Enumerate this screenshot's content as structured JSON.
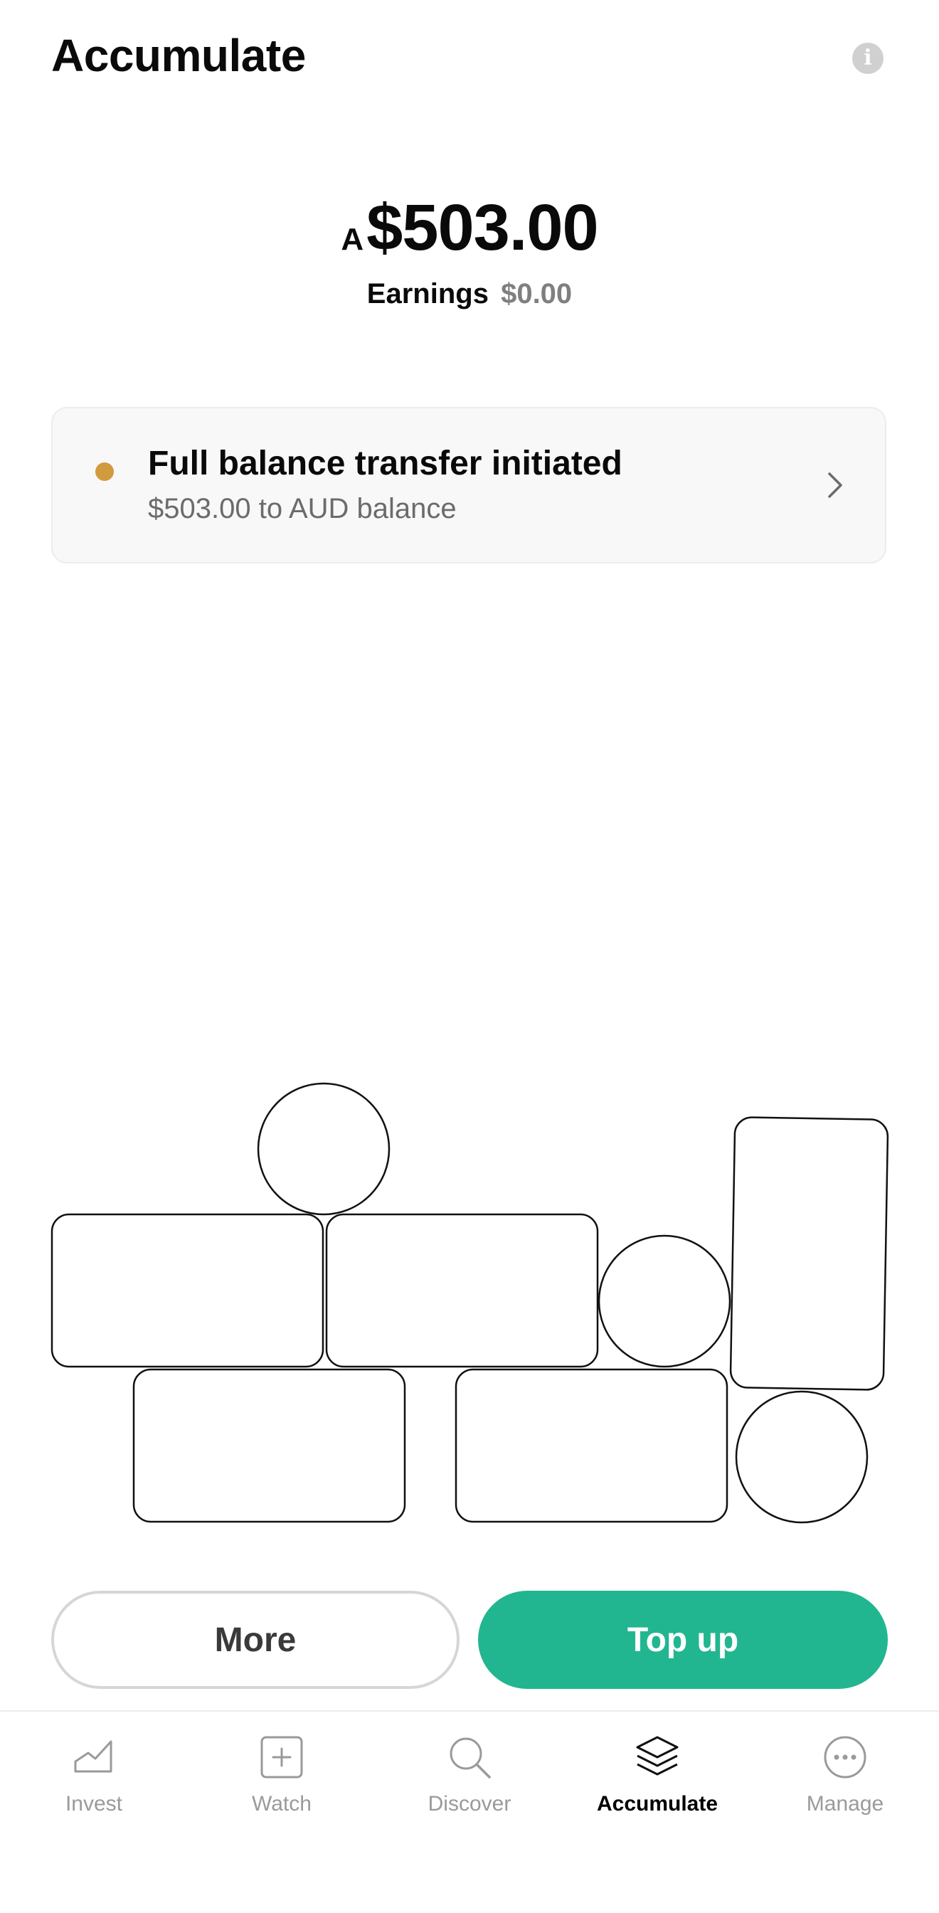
{
  "header": {
    "title": "Accumulate",
    "info_icon": "info-icon",
    "info_glyph": "i"
  },
  "balance": {
    "currency_prefix": "A",
    "amount": "$503.00",
    "earnings_label": "Earnings",
    "earnings_value": "$0.00"
  },
  "notice": {
    "status_color": "#d29a3f",
    "title": "Full balance transfer initiated",
    "subtitle": "$503.00 to AUD balance",
    "chevron_icon": "chevron-right-icon"
  },
  "actions": {
    "more_label": "More",
    "topup_label": "Top up",
    "topup_color": "#21b690"
  },
  "nav": {
    "items": [
      {
        "label": "Invest",
        "icon": "chart-icon",
        "active": false
      },
      {
        "label": "Watch",
        "icon": "add-square-icon",
        "active": false
      },
      {
        "label": "Discover",
        "icon": "search-icon",
        "active": false
      },
      {
        "label": "Accumulate",
        "icon": "layers-icon",
        "active": true
      },
      {
        "label": "Manage",
        "icon": "more-circle-icon",
        "active": false
      }
    ]
  }
}
